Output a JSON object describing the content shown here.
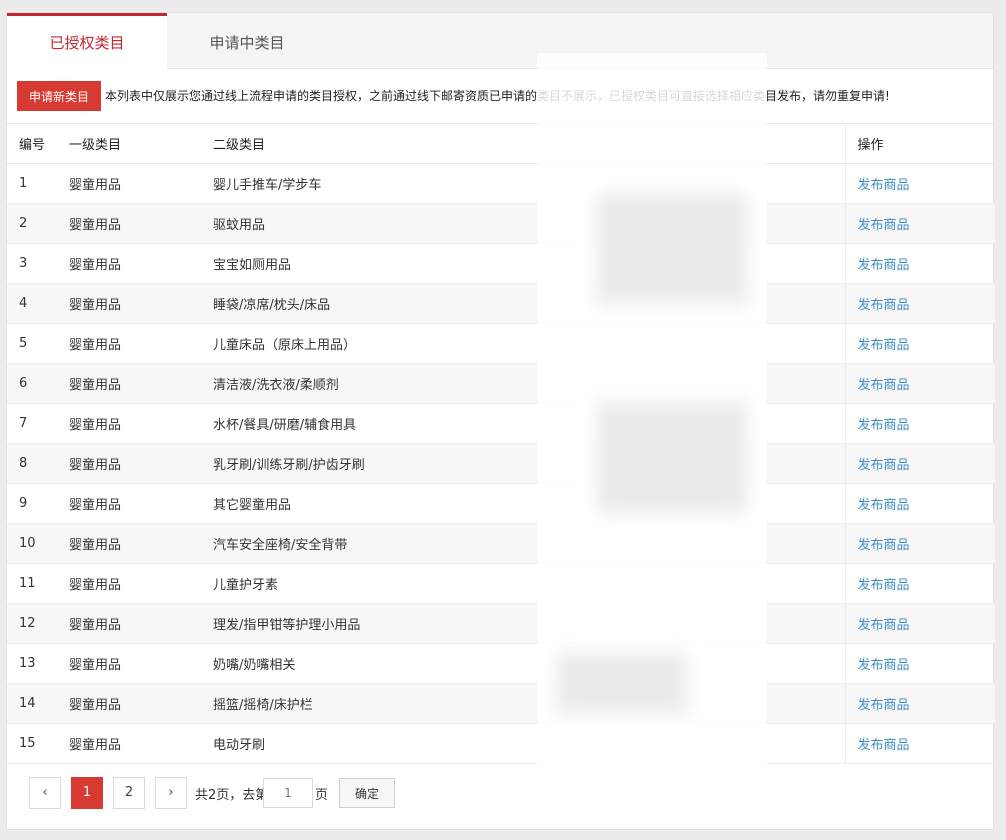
{
  "tabs": [
    {
      "label": "已授权类目",
      "active": true
    },
    {
      "label": "申请中类目",
      "active": false
    }
  ],
  "notice": {
    "button_label": "申请新类目",
    "text": "本列表中仅展示您通过线上流程申请的类目授权，之前通过线下邮寄资质已申请的类目不展示，已授权类目可直接选择相应类目发布，请勿重复申请!"
  },
  "table": {
    "headers": {
      "no": "编号",
      "level1": "一级类目",
      "level2": "二级类目",
      "op": "操作"
    },
    "rows": [
      {
        "no": "1",
        "level1": "婴童用品",
        "level2": "婴儿手推车/学步车",
        "op": "发布商品"
      },
      {
        "no": "2",
        "level1": "婴童用品",
        "level2": "驱蚊用品",
        "op": "发布商品"
      },
      {
        "no": "3",
        "level1": "婴童用品",
        "level2": "宝宝如厕用品",
        "op": "发布商品"
      },
      {
        "no": "4",
        "level1": "婴童用品",
        "level2": "睡袋/凉席/枕头/床品",
        "op": "发布商品"
      },
      {
        "no": "5",
        "level1": "婴童用品",
        "level2": "儿童床品（原床上用品）",
        "op": "发布商品"
      },
      {
        "no": "6",
        "level1": "婴童用品",
        "level2": "清洁液/洗衣液/柔顺剂",
        "op": "发布商品"
      },
      {
        "no": "7",
        "level1": "婴童用品",
        "level2": "水杯/餐具/研磨/辅食用具",
        "op": "发布商品"
      },
      {
        "no": "8",
        "level1": "婴童用品",
        "level2": "乳牙刷/训练牙刷/护齿牙刷",
        "op": "发布商品"
      },
      {
        "no": "9",
        "level1": "婴童用品",
        "level2": "其它婴童用品",
        "op": "发布商品"
      },
      {
        "no": "10",
        "level1": "婴童用品",
        "level2": "汽车安全座椅/安全背带",
        "op": "发布商品"
      },
      {
        "no": "11",
        "level1": "婴童用品",
        "level2": "儿童护牙素",
        "op": "发布商品"
      },
      {
        "no": "12",
        "level1": "婴童用品",
        "level2": "理发/指甲钳等护理小用品",
        "op": "发布商品"
      },
      {
        "no": "13",
        "level1": "婴童用品",
        "level2": "奶嘴/奶嘴相关",
        "op": "发布商品"
      },
      {
        "no": "14",
        "level1": "婴童用品",
        "level2": "摇篮/摇椅/床护栏",
        "op": "发布商品"
      },
      {
        "no": "15",
        "level1": "婴童用品",
        "level2": "电动牙刷",
        "op": "发布商品"
      }
    ]
  },
  "pagination": {
    "prev": "‹",
    "pages": [
      "1",
      "2"
    ],
    "current": "1",
    "next": "›",
    "total_text": "共2页，去第",
    "input_placeholder": "1",
    "page_suffix": "页",
    "confirm_label": "确定"
  },
  "colors": {
    "accent": "#d73a33",
    "link": "#3a8fc8"
  }
}
